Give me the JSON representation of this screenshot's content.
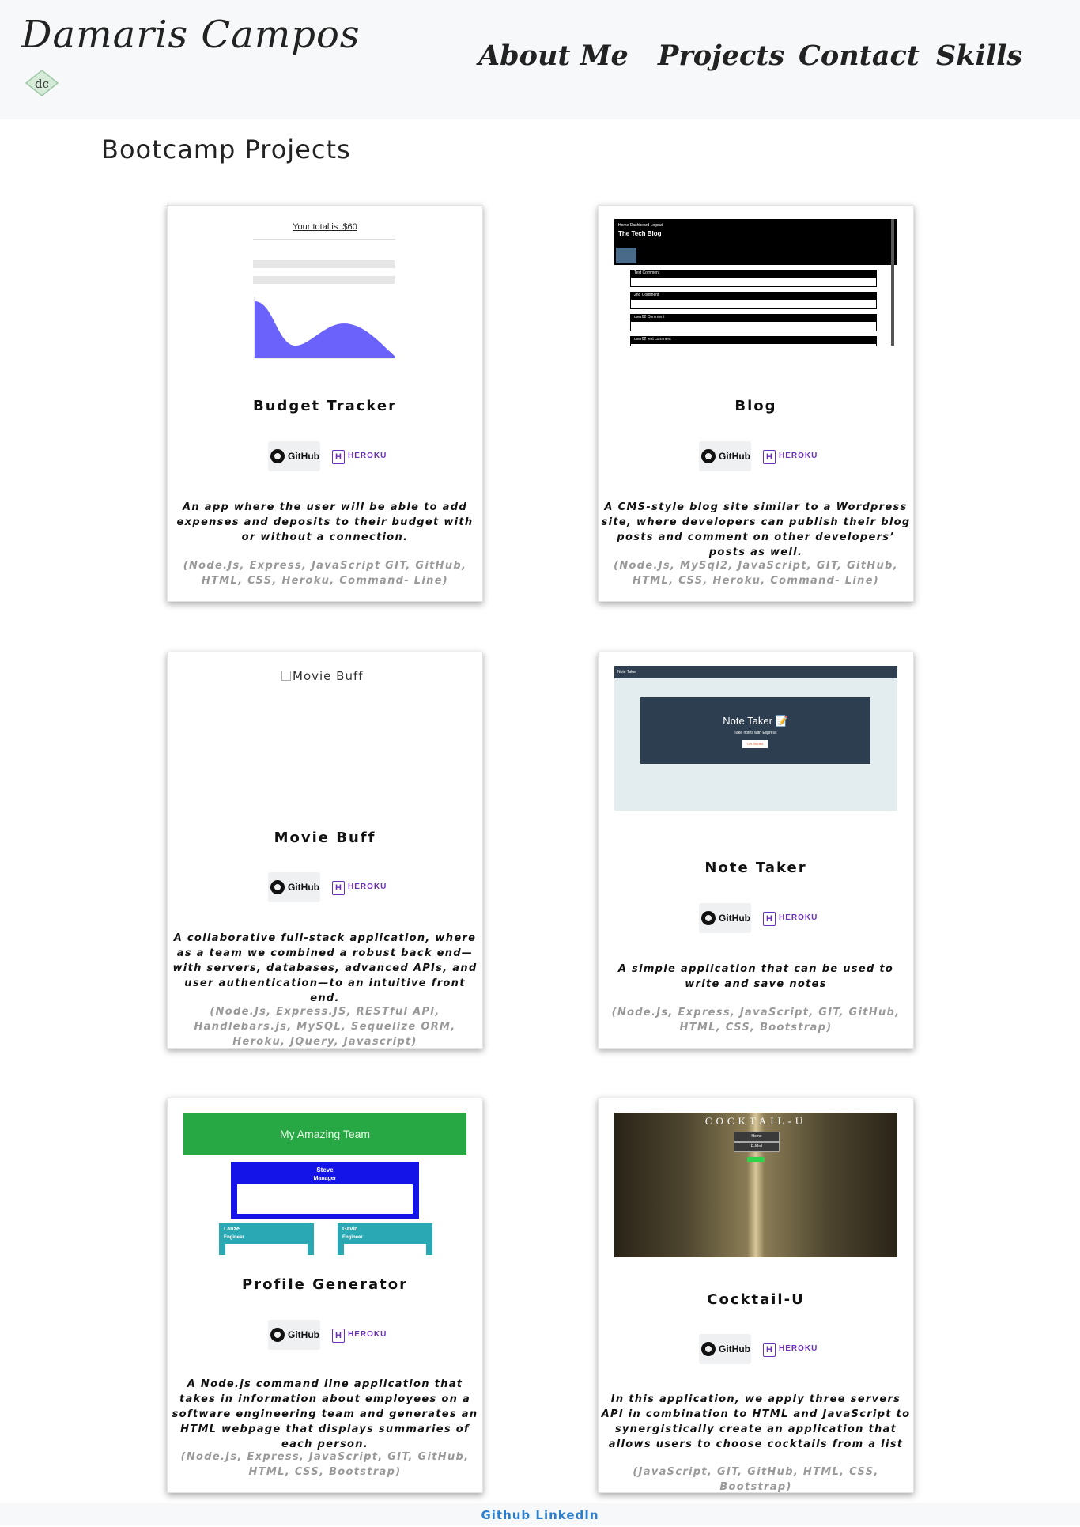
{
  "header": {
    "brand": "Damaris Campos",
    "logo_text": "dc",
    "nav": [
      "About Me",
      "Projects",
      "Contact",
      "Skills"
    ]
  },
  "section_title": "Bootcamp Projects",
  "badges": {
    "github": "GitHub",
    "heroku": "HEROKU",
    "heroku_mark": "H"
  },
  "projects": [
    {
      "title": "Budget Tracker",
      "description": "An app where the user will be able to add expenses and deposits to their budget with or without a connection.",
      "tech": "(Node.Js, Express, JavaScript GIT, GitHub, HTML, CSS, Heroku, Command- Line)",
      "thumb": {
        "total": "Your total is: $60"
      }
    },
    {
      "title": "Blog",
      "description": "A CMS-style blog site similar to a Wordpress site, where developers can publish their blog posts and comment on other developers’ posts as well.",
      "tech": "(Node.Js, MySql2, JavaScript, GIT, GitHub, HTML, CSS, Heroku, Command- Line)",
      "thumb": {
        "heading": "The Tech Blog",
        "nav": "Home   Dashboard   Logout",
        "posts": [
          "Test Comment",
          "2nd Comment",
          "user02 Comment",
          "user02 test comment"
        ]
      }
    },
    {
      "title": "Movie Buff",
      "description": "A collaborative full-stack application, where as a team we combined a robust back end—with servers, databases, advanced APIs, and user authentication—to an intuitive front end.",
      "tech": "(Node.Js, Express.JS, RESTful API, Handlebars.js, MySQL, Sequelize ORM, Heroku, JQuery, Javascript)",
      "thumb": {
        "alt": "Movie Buff"
      }
    },
    {
      "title": "Note Taker",
      "description": "A simple application that can be used to write and save notes",
      "tech": "(Node.Js, Express, JavaScript, GIT, GitHub, HTML, CSS, Bootstrap)",
      "thumb": {
        "bar": "Note Taker",
        "heading": "Note Taker 📝",
        "sub": "Take notes with Express",
        "button": "Get Started"
      }
    },
    {
      "title": "Profile Generator",
      "description": "A Node.js command line application that takes in information about employees on a software engineering team and generates an HTML webpage that displays summaries of each person.",
      "tech": "(Node.Js, Express, JavaScript, GIT, GitHub, HTML, CSS, Bootstrap)",
      "thumb": {
        "banner": "My Amazing Team",
        "manager": "Steve",
        "manager_role": "Manager",
        "eng1": "Lanze",
        "eng2": "Gavin",
        "eng_role": "Engineer"
      }
    },
    {
      "title": "Cocktail-U",
      "description": "In this application, we apply three servers API in combination to HTML and JavaScript to synergistically create an application that allows users to choose cocktails from a list",
      "tech": "(JavaScript, GIT, GitHub, HTML, CSS, Bootstrap)",
      "thumb": {
        "heading": "COCKTAIL-U",
        "btn1": "Home",
        "btn2": "E-Mail"
      }
    }
  ],
  "footer": {
    "github": "Github",
    "linkedin": "LinkedIn"
  },
  "colors": {
    "accent_link": "#2b7fd0",
    "heroku": "#6b2fba",
    "header_bg": "#f7f8f9"
  }
}
